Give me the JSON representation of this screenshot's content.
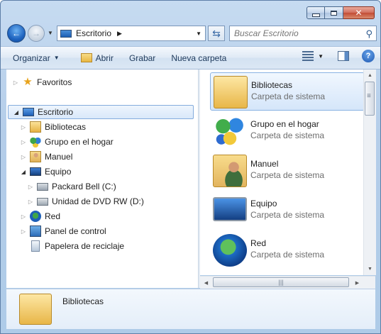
{
  "window": {
    "caption_buttons": [
      "minimize",
      "maximize",
      "close"
    ]
  },
  "nav": {
    "address_label": "Escritorio",
    "address_separator": "▶",
    "search_placeholder": "Buscar Escritorio"
  },
  "toolbar": {
    "organize": "Organizar",
    "open": "Abrir",
    "burn": "Grabar",
    "new_folder": "Nueva carpeta"
  },
  "tree": {
    "favorites": "Favoritos",
    "desktop": "Escritorio",
    "libraries": "Bibliotecas",
    "homegroup": "Grupo en el hogar",
    "user": "Manuel",
    "computer": "Equipo",
    "drive_c": "Packard Bell (C:)",
    "drive_d": "Unidad de DVD RW (D:)",
    "network": "Red",
    "control_panel": "Panel de control",
    "recycle_bin": "Papelera de reciclaje"
  },
  "items": [
    {
      "name": "Bibliotecas",
      "type": "Carpeta de sistema",
      "icon": "libraries-icon"
    },
    {
      "name": "Grupo en el hogar",
      "type": "Carpeta de sistema",
      "icon": "homegroup-icon"
    },
    {
      "name": "Manuel",
      "type": "Carpeta de sistema",
      "icon": "user-folder-icon"
    },
    {
      "name": "Equipo",
      "type": "Carpeta de sistema",
      "icon": "computer-icon"
    },
    {
      "name": "Red",
      "type": "Carpeta de sistema",
      "icon": "network-icon"
    }
  ],
  "details": {
    "name": "Bibliotecas"
  }
}
